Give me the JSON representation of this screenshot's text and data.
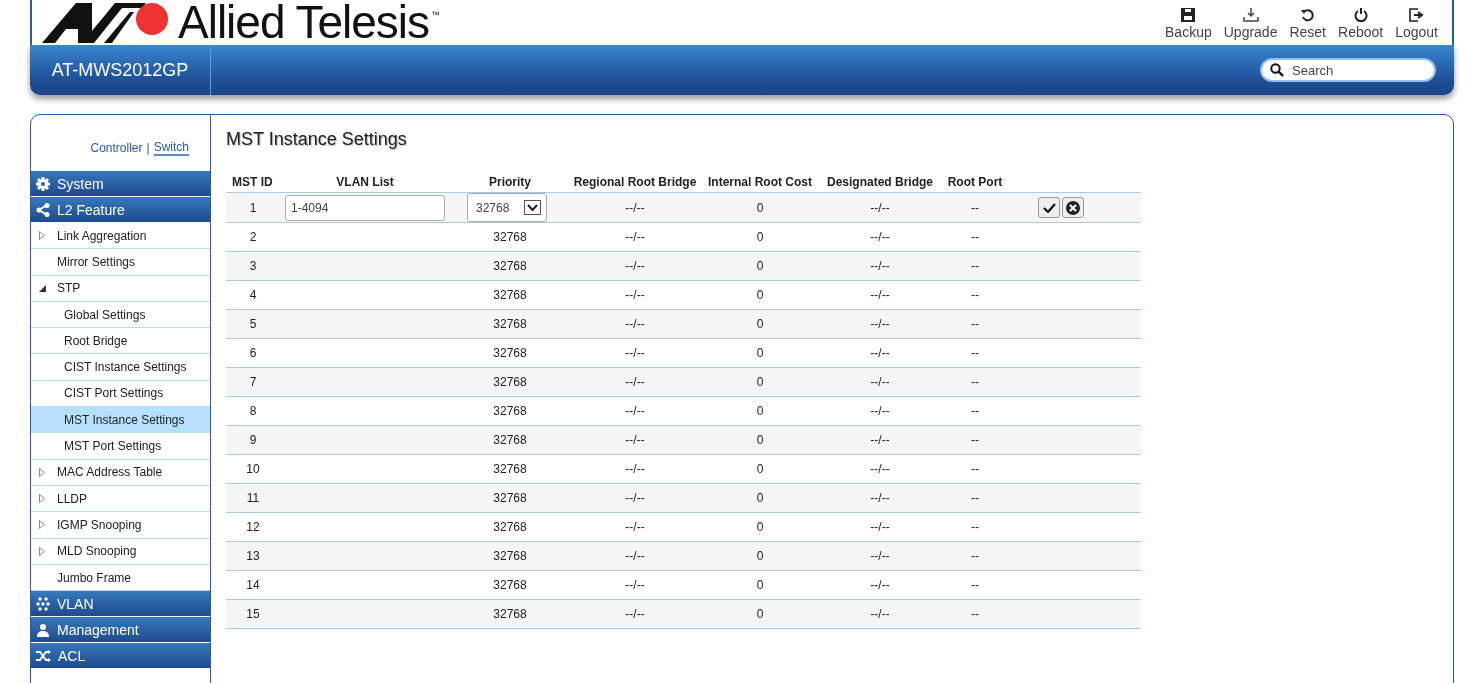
{
  "header": {
    "brand": "Allied Telesis",
    "trademark": "™",
    "model": "AT-MWS2012GP",
    "actions": [
      {
        "kind": "backup",
        "label": "Backup"
      },
      {
        "kind": "upgrade",
        "label": "Upgrade"
      },
      {
        "kind": "reset",
        "label": "Reset"
      },
      {
        "kind": "reboot",
        "label": "Reboot"
      },
      {
        "kind": "logout",
        "label": "Logout"
      }
    ],
    "search": {
      "placeholder": "Search"
    }
  },
  "mode_tabs": [
    {
      "label": "Controller",
      "selected": false
    },
    {
      "label": "Switch",
      "selected": true
    }
  ],
  "mode_separator": "|",
  "sidebar": [
    {
      "kind": "section",
      "label": "System",
      "selected": false
    },
    {
      "kind": "section",
      "label": "L2 Feature",
      "selected": false,
      "children": [
        {
          "label": "Link Aggregation",
          "expanded": false,
          "selected": false
        },
        {
          "label": "Mirror Settings",
          "selected": false
        },
        {
          "label": "STP",
          "expanded": true,
          "selected": false,
          "children": [
            {
              "label": "Global Settings",
              "selected": false
            },
            {
              "label": "Root Bridge",
              "selected": false
            },
            {
              "label": "CIST Instance Settings",
              "selected": false
            },
            {
              "label": "CIST Port Settings",
              "selected": false
            },
            {
              "label": "MST Instance Settings",
              "selected": true
            },
            {
              "label": "MST Port Settings",
              "selected": false
            }
          ]
        },
        {
          "label": "MAC Address Table",
          "expanded": false,
          "selected": false
        },
        {
          "label": "LLDP",
          "expanded": false,
          "selected": false
        },
        {
          "label": "IGMP Snooping",
          "expanded": false,
          "selected": false
        },
        {
          "label": "MLD Snooping",
          "expanded": false,
          "selected": false
        },
        {
          "label": "Jumbo Frame",
          "selected": false
        }
      ]
    },
    {
      "kind": "section",
      "label": "VLAN",
      "selected": false
    },
    {
      "kind": "section",
      "label": "Management",
      "selected": false
    },
    {
      "kind": "section",
      "label": "ACL",
      "selected": false
    }
  ],
  "page_title": "MST Instance Settings",
  "table": {
    "columns": [
      "MST ID",
      "VLAN List",
      "Priority",
      "Regional Root Bridge",
      "Internal Root Cost",
      "Designated Bridge",
      "Root Port"
    ],
    "rows": [
      {
        "editing": true,
        "cells": [
          "1",
          "1-4094",
          "32768",
          "--/--",
          "0",
          "--/--",
          "--"
        ]
      },
      {
        "editing": false,
        "cells": [
          "2",
          "",
          "32768",
          "--/--",
          "0",
          "--/--",
          "--"
        ]
      },
      {
        "editing": false,
        "cells": [
          "3",
          "",
          "32768",
          "--/--",
          "0",
          "--/--",
          "--"
        ]
      },
      {
        "editing": false,
        "cells": [
          "4",
          "",
          "32768",
          "--/--",
          "0",
          "--/--",
          "--"
        ]
      },
      {
        "editing": false,
        "cells": [
          "5",
          "",
          "32768",
          "--/--",
          "0",
          "--/--",
          "--"
        ]
      },
      {
        "editing": false,
        "cells": [
          "6",
          "",
          "32768",
          "--/--",
          "0",
          "--/--",
          "--"
        ]
      },
      {
        "editing": false,
        "cells": [
          "7",
          "",
          "32768",
          "--/--",
          "0",
          "--/--",
          "--"
        ]
      },
      {
        "editing": false,
        "cells": [
          "8",
          "",
          "32768",
          "--/--",
          "0",
          "--/--",
          "--"
        ]
      },
      {
        "editing": false,
        "cells": [
          "9",
          "",
          "32768",
          "--/--",
          "0",
          "--/--",
          "--"
        ]
      },
      {
        "editing": false,
        "cells": [
          "10",
          "",
          "32768",
          "--/--",
          "0",
          "--/--",
          "--"
        ]
      },
      {
        "editing": false,
        "cells": [
          "11",
          "",
          "32768",
          "--/--",
          "0",
          "--/--",
          "--"
        ]
      },
      {
        "editing": false,
        "cells": [
          "12",
          "",
          "32768",
          "--/--",
          "0",
          "--/--",
          "--"
        ]
      },
      {
        "editing": false,
        "cells": [
          "13",
          "",
          "32768",
          "--/--",
          "0",
          "--/--",
          "--"
        ]
      },
      {
        "editing": false,
        "cells": [
          "14",
          "",
          "32768",
          "--/--",
          "0",
          "--/--",
          "--"
        ]
      },
      {
        "editing": false,
        "cells": [
          "15",
          "",
          "32768",
          "--/--",
          "0",
          "--/--",
          "--"
        ]
      }
    ]
  }
}
